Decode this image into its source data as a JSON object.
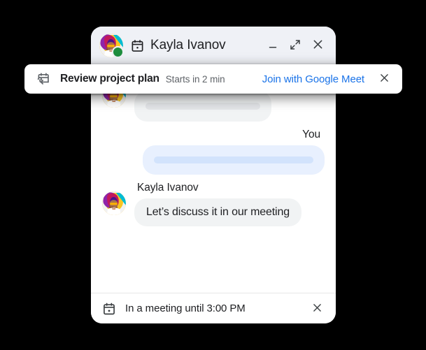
{
  "window": {
    "title": "Kayla Ivanov",
    "title_icon": "calendar-icon",
    "avatar": {
      "name": "avatar",
      "presence": "online",
      "presence_color": "#1e8e3e"
    },
    "controls": {
      "minimize_label": "Minimize",
      "minimize_icon": "minimize-icon",
      "expand_label": "Expand",
      "expand_icon": "expand-icon",
      "close_label": "Close",
      "close_icon": "close-icon"
    }
  },
  "banner": {
    "icon": "calendar-arrow-icon",
    "title": "Review project plan",
    "subtitle": "Starts in 2 min",
    "action_label": "Join with Google Meet",
    "action_color": "#1a73e8",
    "close_icon": "close-icon"
  },
  "conversation": {
    "messages": [
      {
        "sender": "Kayla Ivanov",
        "direction": "incoming",
        "type": "placeholder",
        "text": "",
        "bubble_color": "#f1f3f4",
        "skeleton_color": "#e3e5e8"
      },
      {
        "sender": "You",
        "direction": "outgoing",
        "type": "placeholder",
        "text": "",
        "bubble_color": "#e8f0fe",
        "skeleton_color": "#d2e3fc"
      },
      {
        "sender": "Kayla Ivanov",
        "direction": "incoming",
        "type": "text",
        "text": "Let’s discuss it in our meeting",
        "bubble_color": "#f1f3f4",
        "skeleton_color": ""
      }
    ]
  },
  "status_bar": {
    "icon": "calendar-busy-icon",
    "text": "In a meeting until 3:00 PM",
    "close_icon": "close-icon"
  }
}
